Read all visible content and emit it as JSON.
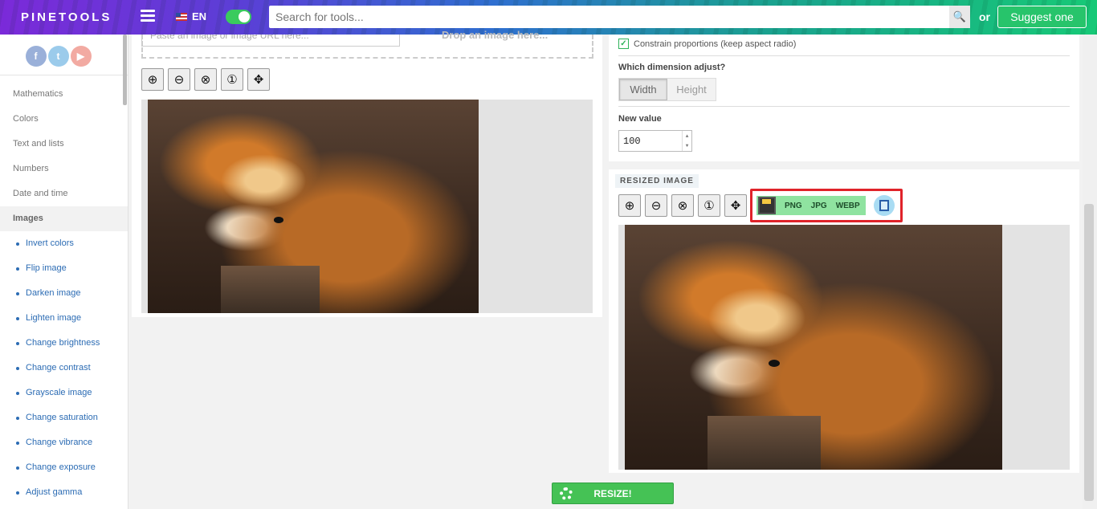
{
  "header": {
    "logo": "PINETOOLS",
    "language": "EN",
    "search_placeholder": "Search for tools...",
    "or_label": "or",
    "suggest_label": "Suggest one"
  },
  "social": {
    "facebook": "f",
    "twitter": "t",
    "youtube": "▶"
  },
  "sidebar": {
    "categories": [
      "Mathematics",
      "Colors",
      "Text and lists",
      "Numbers",
      "Date and time",
      "Images"
    ],
    "active": "Images",
    "image_tools": [
      "Invert colors",
      "Flip image",
      "Darken image",
      "Lighten image",
      "Change brightness",
      "Change contrast",
      "Grayscale image",
      "Change saturation",
      "Change vibrance",
      "Change exposure",
      "Adjust gamma"
    ]
  },
  "left": {
    "url_placeholder": "Paste an image or image URL here...",
    "drop_hint": "Drop an image here..."
  },
  "options": {
    "constrain_label": "Constrain proportions (keep aspect radio)",
    "dimension_label": "Which dimension adjust?",
    "width_label": "Width",
    "height_label": "Height",
    "new_value_label": "New value",
    "new_value": "100"
  },
  "resized": {
    "title": "RESIZED IMAGE",
    "formats": [
      "PNG",
      "JPG",
      "WEBP"
    ]
  },
  "resize_button": "RESIZE!",
  "colors": {
    "accent_green": "#45c255",
    "highlight_red": "#e0232a"
  }
}
